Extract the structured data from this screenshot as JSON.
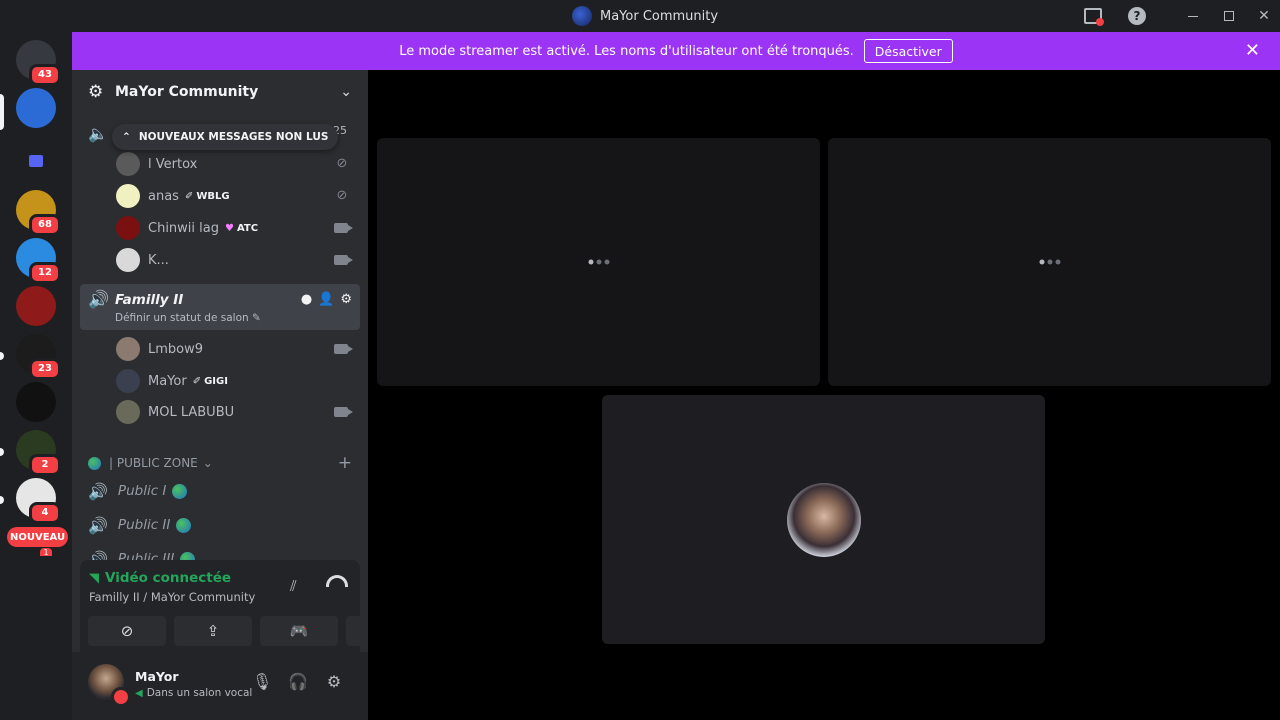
{
  "window": {
    "title": "MaYor Community"
  },
  "banner": {
    "message": "Le mode streamer est activé. Les noms d'utilisateur ont été tronqués.",
    "button": "Désactiver"
  },
  "rail": {
    "servers": [
      {
        "name": "direct-messages",
        "badge": "43",
        "color": "#36393f"
      },
      {
        "name": "mayor-community",
        "badge": "",
        "color": "#2b6bd6"
      },
      {
        "name": "folder",
        "badge": "",
        "color": "#5865f2"
      },
      {
        "name": "server-pc",
        "badge": "68",
        "color": "#c5921a"
      },
      {
        "name": "server-cap",
        "badge": "12",
        "color": "#2a8be0"
      },
      {
        "name": "server-red",
        "badge": "",
        "color": "#8e1a1a"
      },
      {
        "name": "server-gold",
        "badge": "23",
        "color": "#1c1c1c"
      },
      {
        "name": "server-tc",
        "badge": "",
        "color": "#111"
      },
      {
        "name": "server-group",
        "badge": "2",
        "color": "#2b3b22"
      },
      {
        "name": "server-art",
        "badge": "4",
        "color": "#e6e6e6"
      }
    ],
    "new_label": "NOUVEAU",
    "new_count": "1"
  },
  "sidebar": {
    "server_name": "MaYor Community",
    "unread_pill": "NOUVEAUX MESSAGES NON LUS",
    "unread_count": "25",
    "top_users": [
      {
        "name": "l Vertox",
        "tag": "",
        "icon": "muted",
        "avatar": "#5a5a5a"
      },
      {
        "name": "anas",
        "tag": "WBLG",
        "tag_icon": "✐",
        "icon": "muted",
        "avatar": "#f0f0c0"
      },
      {
        "name": "Chinwii lag",
        "tag": "ATC",
        "tag_icon": "♥",
        "icon": "camera",
        "avatar": "#7a1010"
      },
      {
        "name": "K...",
        "tag": "",
        "icon": "camera",
        "avatar": "#d9d9d9"
      }
    ],
    "voice_channel": {
      "name": "Familly II",
      "status": "Définir un statut de salon ✎"
    },
    "channel_users": [
      {
        "name": "Lmbow9",
        "tag": "",
        "icon": "camera",
        "avatar": "#8a7a70"
      },
      {
        "name": "MaYor",
        "tag": "GIGI",
        "tag_icon": "✐",
        "icon": "",
        "avatar": "#3a4050"
      },
      {
        "name": "MOL LABUBU",
        "tag": "",
        "icon": "camera",
        "avatar": "#6a6a5a"
      }
    ],
    "category": "| PUBLIC ZONE",
    "public_channels": [
      "Public I",
      "Public II",
      "Public III"
    ]
  },
  "voice_panel": {
    "status": "Vidéo connectée",
    "location": "Familly II / MaYor Community"
  },
  "user_panel": {
    "name": "MaYor",
    "status": "Dans un salon vocal"
  },
  "colors": {
    "banner": "#9b34f5",
    "connected": "#23a55a",
    "badge": "#f23f43"
  }
}
